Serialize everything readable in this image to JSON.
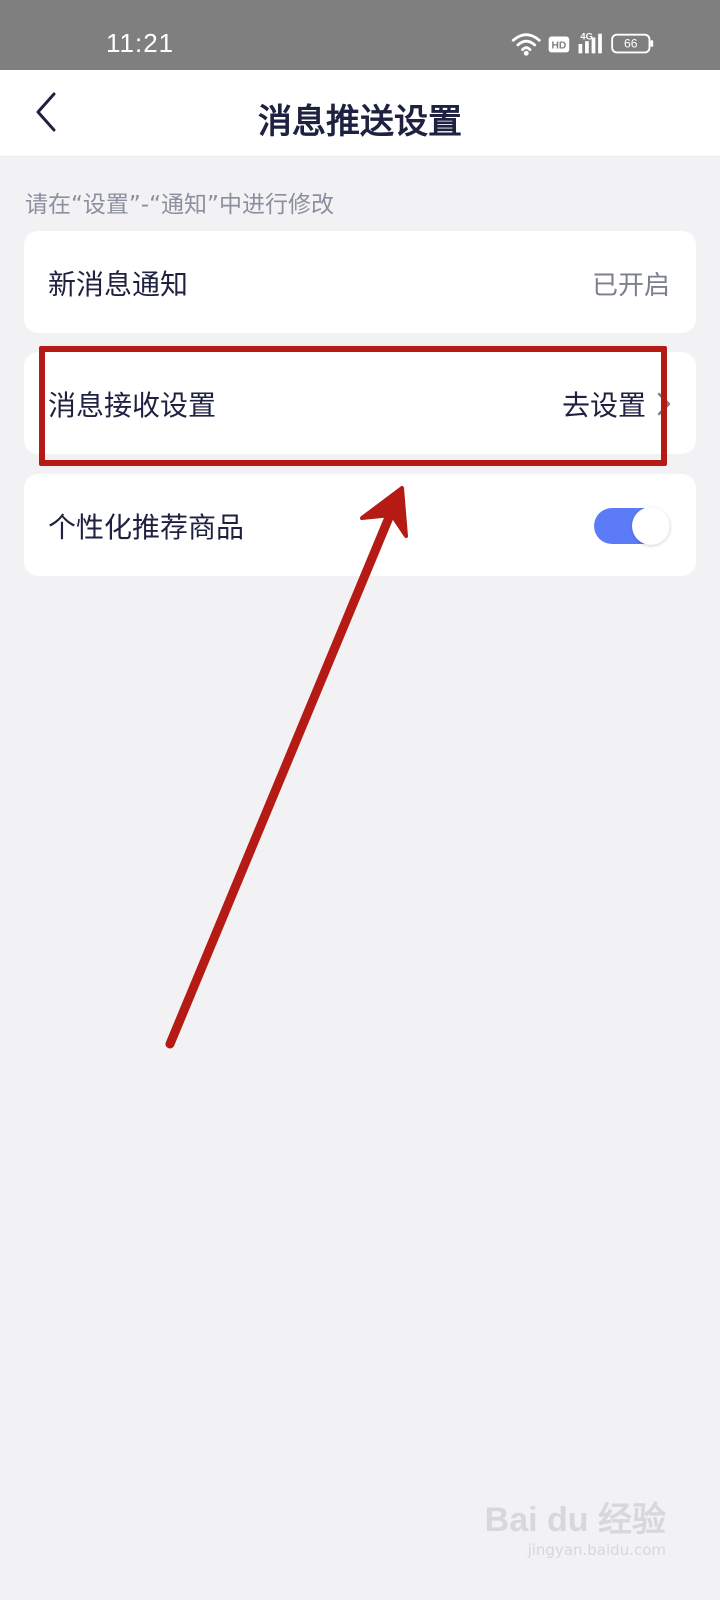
{
  "status_bar": {
    "time": "11:21",
    "hd_label": "HD",
    "network_label": "4G",
    "battery": "66"
  },
  "nav": {
    "title": "消息推送设置",
    "back_icon": "chevron-left-icon"
  },
  "hint": "请在“设置”-“通知”中进行修改",
  "settings": [
    {
      "label": "新消息通知",
      "value": "已开启"
    },
    {
      "label": "消息接收设置",
      "value": "去设置",
      "icon": "chevron-right-icon"
    },
    {
      "label": "个性化推荐商品",
      "toggle_on": true
    }
  ],
  "annotation": {
    "color": "#b51b14",
    "shapes": [
      "highlight-box",
      "arrow"
    ]
  },
  "watermark": {
    "logo": "Bai du 经验",
    "url": "jingyan.baidu.com"
  },
  "colors": {
    "accent_toggle": "#5b7cf6",
    "background": "#f2f2f4",
    "status_bar": "#7f7f7f"
  }
}
